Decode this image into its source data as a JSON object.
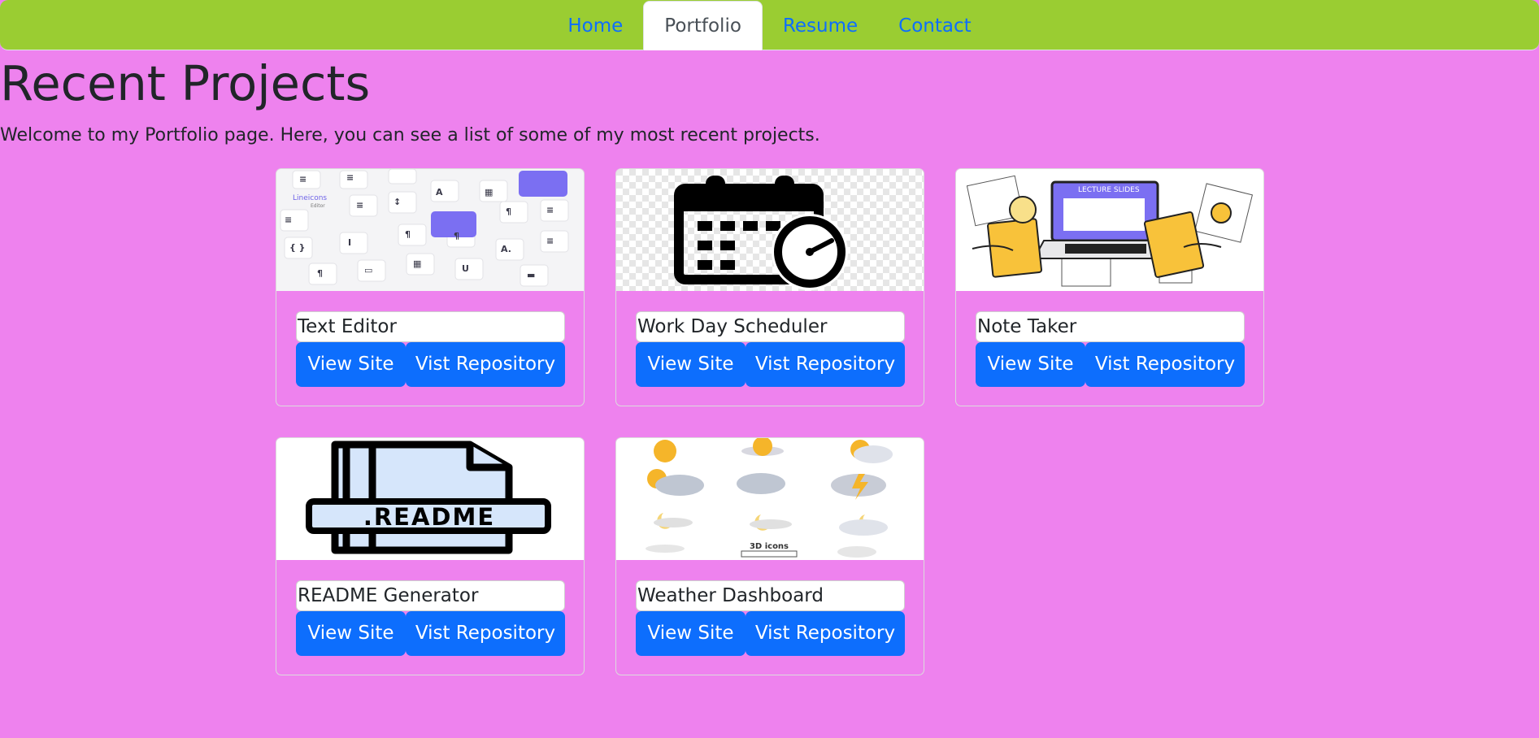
{
  "nav": {
    "items": [
      {
        "label": "Home",
        "active": false
      },
      {
        "label": "Portfolio",
        "active": true
      },
      {
        "label": "Resume",
        "active": false
      },
      {
        "label": "Contact",
        "active": false
      }
    ]
  },
  "page": {
    "title": "Recent Projects",
    "intro": "Welcome to my Portfolio page. Here, you can see a list of some of my most recent projects."
  },
  "projects": [
    {
      "title": "Text Editor",
      "view_label": "View Site",
      "repo_label": "Vist Repository",
      "image": "text-editor-icons-image"
    },
    {
      "title": "Work Day Scheduler",
      "view_label": "View Site",
      "repo_label": "Vist Repository",
      "image": "calendar-clock-image"
    },
    {
      "title": "Note Taker",
      "view_label": "View Site",
      "repo_label": "Vist Repository",
      "image": "lecture-slides-illustration"
    },
    {
      "title": "README Generator",
      "view_label": "View Site",
      "repo_label": "Vist Repository",
      "image": "readme-file-icon",
      "image_text": ".README"
    },
    {
      "title": "Weather Dashboard",
      "view_label": "View Site",
      "repo_label": "Vist Repository",
      "image": "weather-3d-icons-image",
      "image_text": "3D icons"
    }
  ],
  "images": {
    "text_editor_logo": "Lineicons",
    "text_editor_sub": "Editor",
    "lecture": "LECTURE SLIDES"
  },
  "colors": {
    "navbar": "#9acd32",
    "background": "#ee82ee",
    "button": "#0d6efd",
    "link": "#0d6efd"
  }
}
